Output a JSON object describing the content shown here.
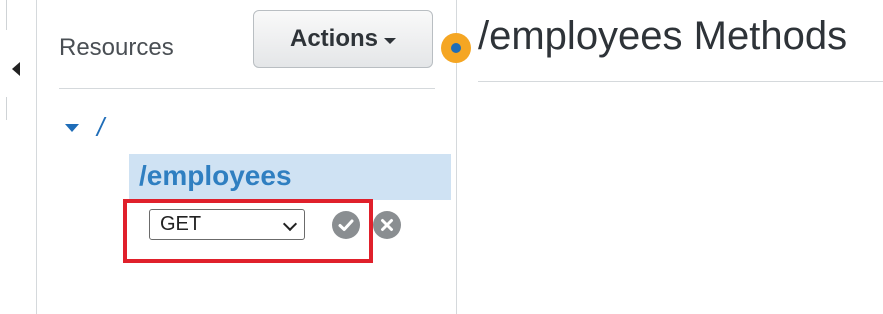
{
  "sidebar": {
    "title": "Resources",
    "actions_label": "Actions",
    "tree": {
      "root_label": "/",
      "children": [
        {
          "label": "/employees",
          "selected": true
        }
      ]
    },
    "method_editor": {
      "selected_method": "GET",
      "highlight_color": "#e0202b"
    }
  },
  "main": {
    "title": "/employees Methods"
  },
  "icons": {
    "collapse": "caret-left-icon",
    "actions_dropdown": "caret-down-icon",
    "tree_toggle": "caret-down-icon",
    "confirm": "check-circle-icon",
    "cancel": "x-circle-icon",
    "info": "info-dot-icon"
  },
  "colors": {
    "link_blue": "#1f6db8",
    "selected_row": "#cfe2f3",
    "info_orange": "#f5a623"
  }
}
